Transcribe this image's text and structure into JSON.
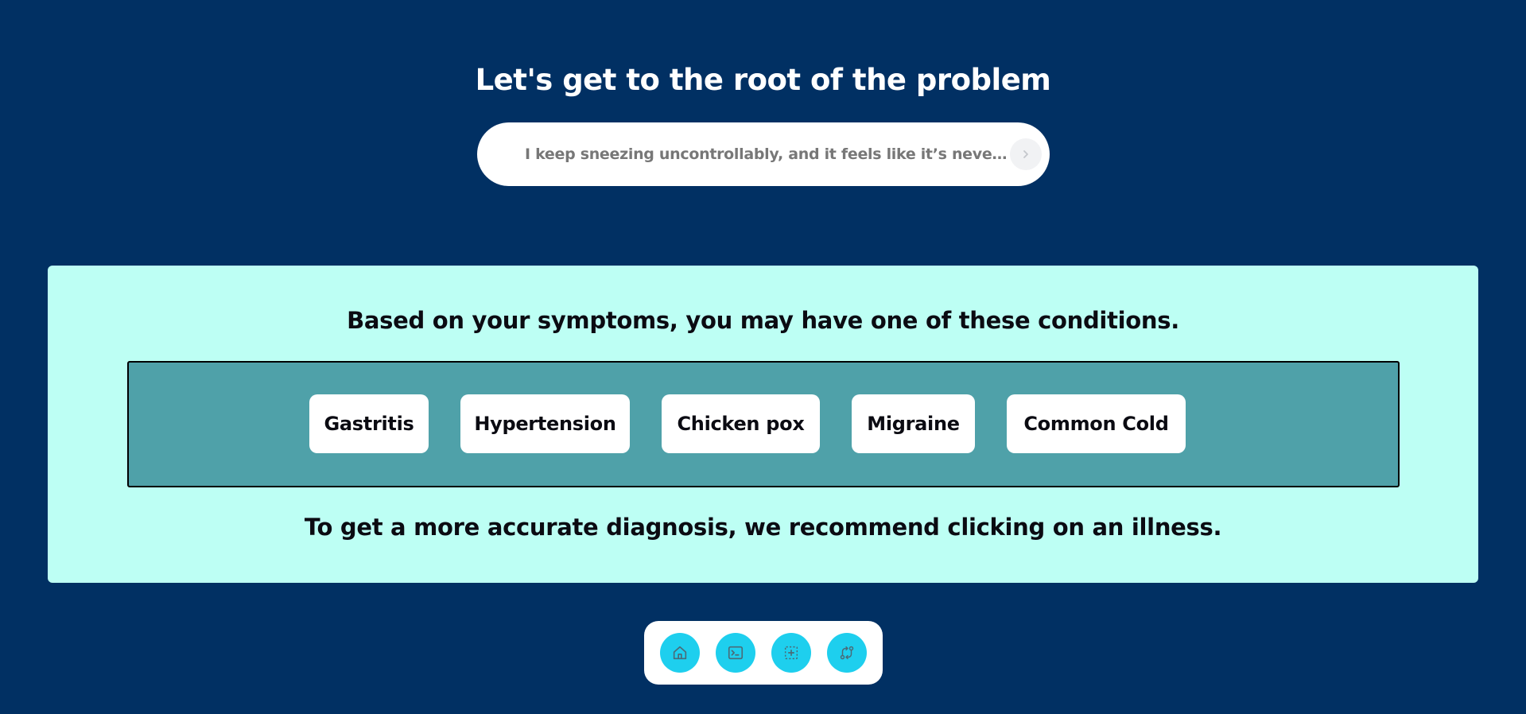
{
  "header": {
    "title": "Let's get to the root of the problem"
  },
  "search": {
    "value": "I keep sneezing uncontrollably, and it feels like it’s never going to stop",
    "submit_icon": "chevron-right-icon"
  },
  "results": {
    "title": "Based on your symptoms, you may have one of these conditions.",
    "conditions": [
      {
        "label": "Gastritis"
      },
      {
        "label": "Hypertension"
      },
      {
        "label": "Chicken pox"
      },
      {
        "label": "Migraine"
      },
      {
        "label": "Common Cold"
      }
    ],
    "footer": "To get a more accurate diagnosis, we recommend clicking on an illness."
  },
  "dock": {
    "items": [
      {
        "icon": "home-icon"
      },
      {
        "icon": "terminal-icon"
      },
      {
        "icon": "dashed-add-icon"
      },
      {
        "icon": "swap-icon"
      }
    ]
  },
  "colors": {
    "background": "#013063",
    "panel": "#bdfff4",
    "conditions_box": "#4fa1a9",
    "dock_button": "#1ecfee"
  }
}
